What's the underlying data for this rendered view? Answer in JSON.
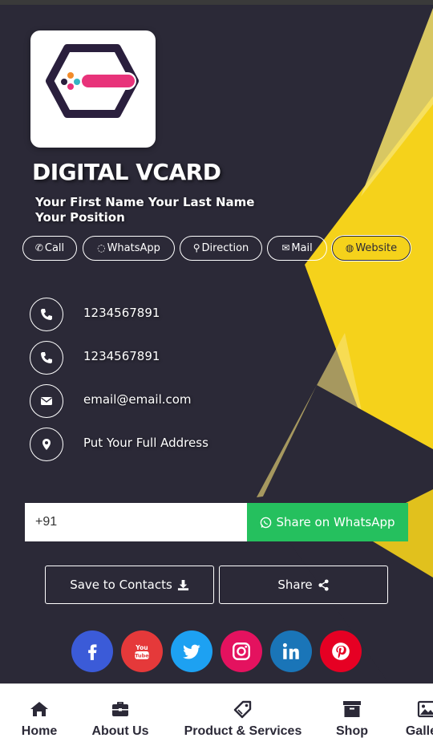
{
  "header": {
    "title": "DIGITAL VCARD",
    "name": "Your First Name Your Last Name",
    "position": "Your Position"
  },
  "actions": [
    {
      "label": "Call",
      "icon": "phone-icon"
    },
    {
      "label": "WhatsApp",
      "icon": "whatsapp-icon"
    },
    {
      "label": "Direction",
      "icon": "map-marker-icon"
    },
    {
      "label": "Mail",
      "icon": "envelope-icon"
    },
    {
      "label": "Website",
      "icon": "globe-icon"
    }
  ],
  "contacts": [
    {
      "text": "1234567891",
      "icon": "phone-icon"
    },
    {
      "text": "1234567891",
      "icon": "phone-icon"
    },
    {
      "text": "email@email.com",
      "icon": "envelope-icon"
    },
    {
      "text": "Put Your Full Address",
      "icon": "map-marker-icon"
    }
  ],
  "whatsapp_share": {
    "input_value": "+91",
    "button_label": "Share on WhatsApp"
  },
  "buttons": {
    "save_label": "Save to Contacts",
    "share_label": "Share"
  },
  "social": [
    {
      "name": "facebook",
      "color": "#3b5bd8"
    },
    {
      "name": "youtube",
      "color": "#e5393a"
    },
    {
      "name": "twitter",
      "color": "#1da1f2"
    },
    {
      "name": "instagram",
      "color": "#e4125f"
    },
    {
      "name": "linkedin",
      "color": "#1a75b8"
    },
    {
      "name": "pinterest",
      "color": "#e60023"
    }
  ],
  "bottom_nav": [
    {
      "label": "Home",
      "icon": "home-icon"
    },
    {
      "label": "About Us",
      "icon": "briefcase-icon"
    },
    {
      "label": "Product & Services",
      "icon": "tag-icon"
    },
    {
      "label": "Shop",
      "icon": "archive-icon"
    },
    {
      "label": "Gallery",
      "icon": "image-icon"
    }
  ],
  "colors": {
    "background": "#2b2937",
    "accent_yellow": "#f5d21b",
    "whatsapp_green": "#25c05e"
  }
}
